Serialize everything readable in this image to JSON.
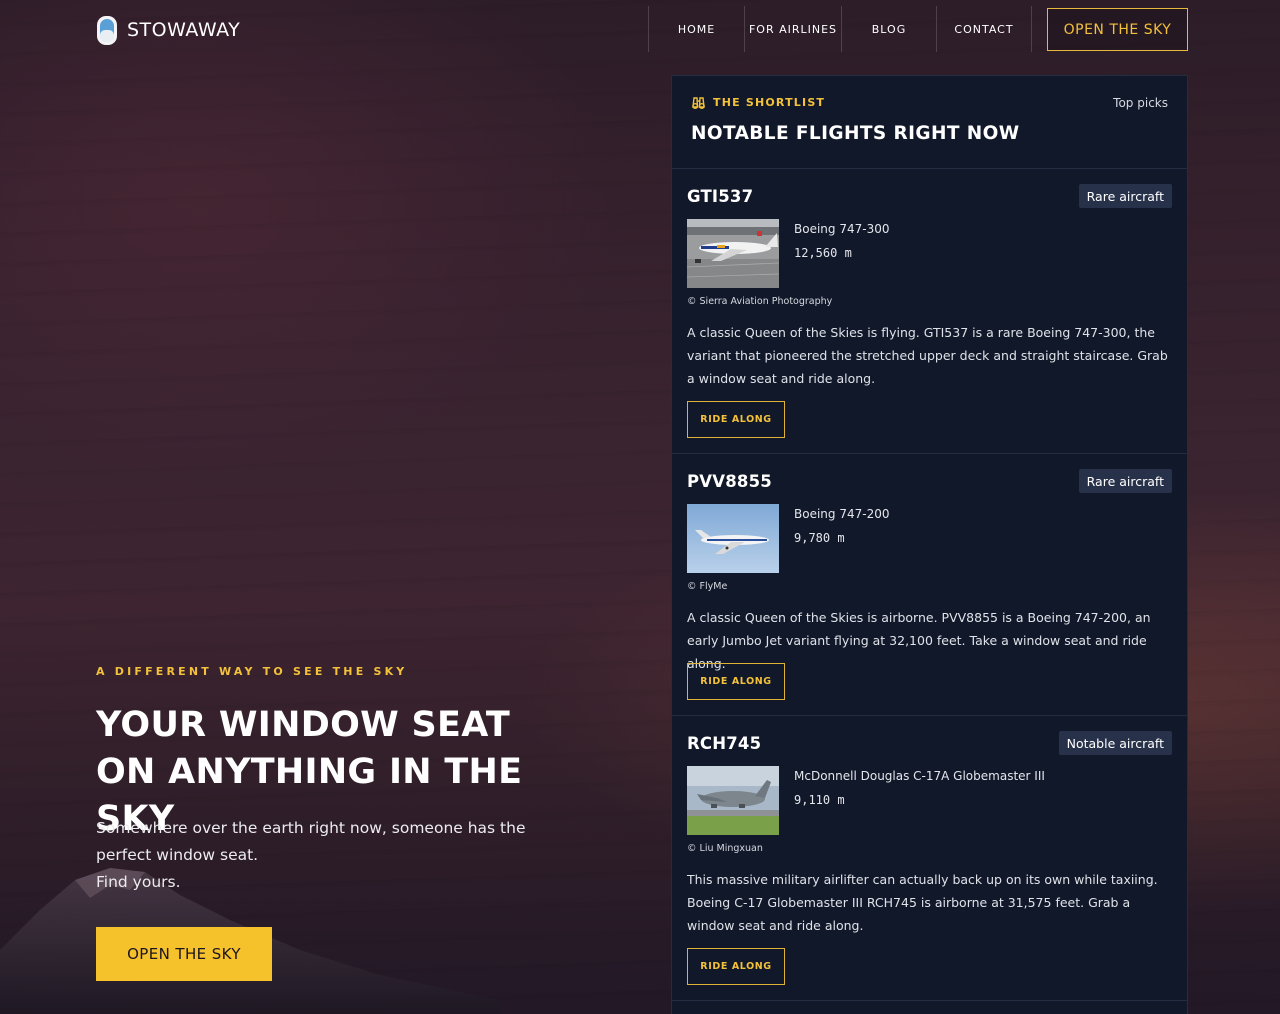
{
  "brand": {
    "name": "STOWAWAY",
    "icon": "window-seat-icon"
  },
  "nav": {
    "items": [
      "HOME",
      "FOR AIRLINES",
      "BLOG",
      "CONTACT"
    ],
    "cta": "OPEN THE SKY"
  },
  "hero": {
    "eyebrow": "A DIFFERENT WAY TO SEE THE SKY",
    "title": "YOUR WINDOW SEAT ON ANYTHING IN THE SKY",
    "subtitle_line1": "Somewhere over the earth right now, someone has the perfect window seat.",
    "subtitle_line2": "Find yours.",
    "cta": "OPEN THE SKY"
  },
  "shortlist": {
    "eyebrow": "THE SHORTLIST",
    "eyebrow_icon": "binoculars-icon",
    "title": "NOTABLE FLIGHTS RIGHT NOW",
    "top_picks": "Top picks",
    "flights": [
      {
        "id": "GTI537",
        "badge": "Rare aircraft",
        "aircraft": "Boeing 747-300",
        "altitude": "12,560 m",
        "credit": "© Sierra Aviation Photography",
        "description": "A classic Queen of the Skies is flying. GTI537 is a rare Boeing 747-300, the variant that pioneered the stretched upper deck and straight staircase. Grab a window seat and ride along.",
        "cta": "RIDE ALONG"
      },
      {
        "id": "PVV8855",
        "badge": "Rare aircraft",
        "aircraft": "Boeing 747-200",
        "altitude": "9,780 m",
        "credit": "© FlyMe",
        "description": "A classic Queen of the Skies is airborne. PVV8855 is a Boeing 747-200, an early Jumbo Jet variant flying at 32,100 feet. Take a window seat and ride along.",
        "cta": "RIDE ALONG"
      },
      {
        "id": "RCH745",
        "badge": "Notable aircraft",
        "aircraft": "McDonnell Douglas C-17A Globemaster III",
        "altitude": "9,110 m",
        "credit": "© Liu Mingxuan",
        "description": "This massive military airlifter can actually back up on its own while taxiing. Boeing C-17 Globemaster III RCH745 is airborne at 31,575 feet. Grab a window seat and ride along.",
        "cta": "RIDE ALONG"
      }
    ]
  }
}
